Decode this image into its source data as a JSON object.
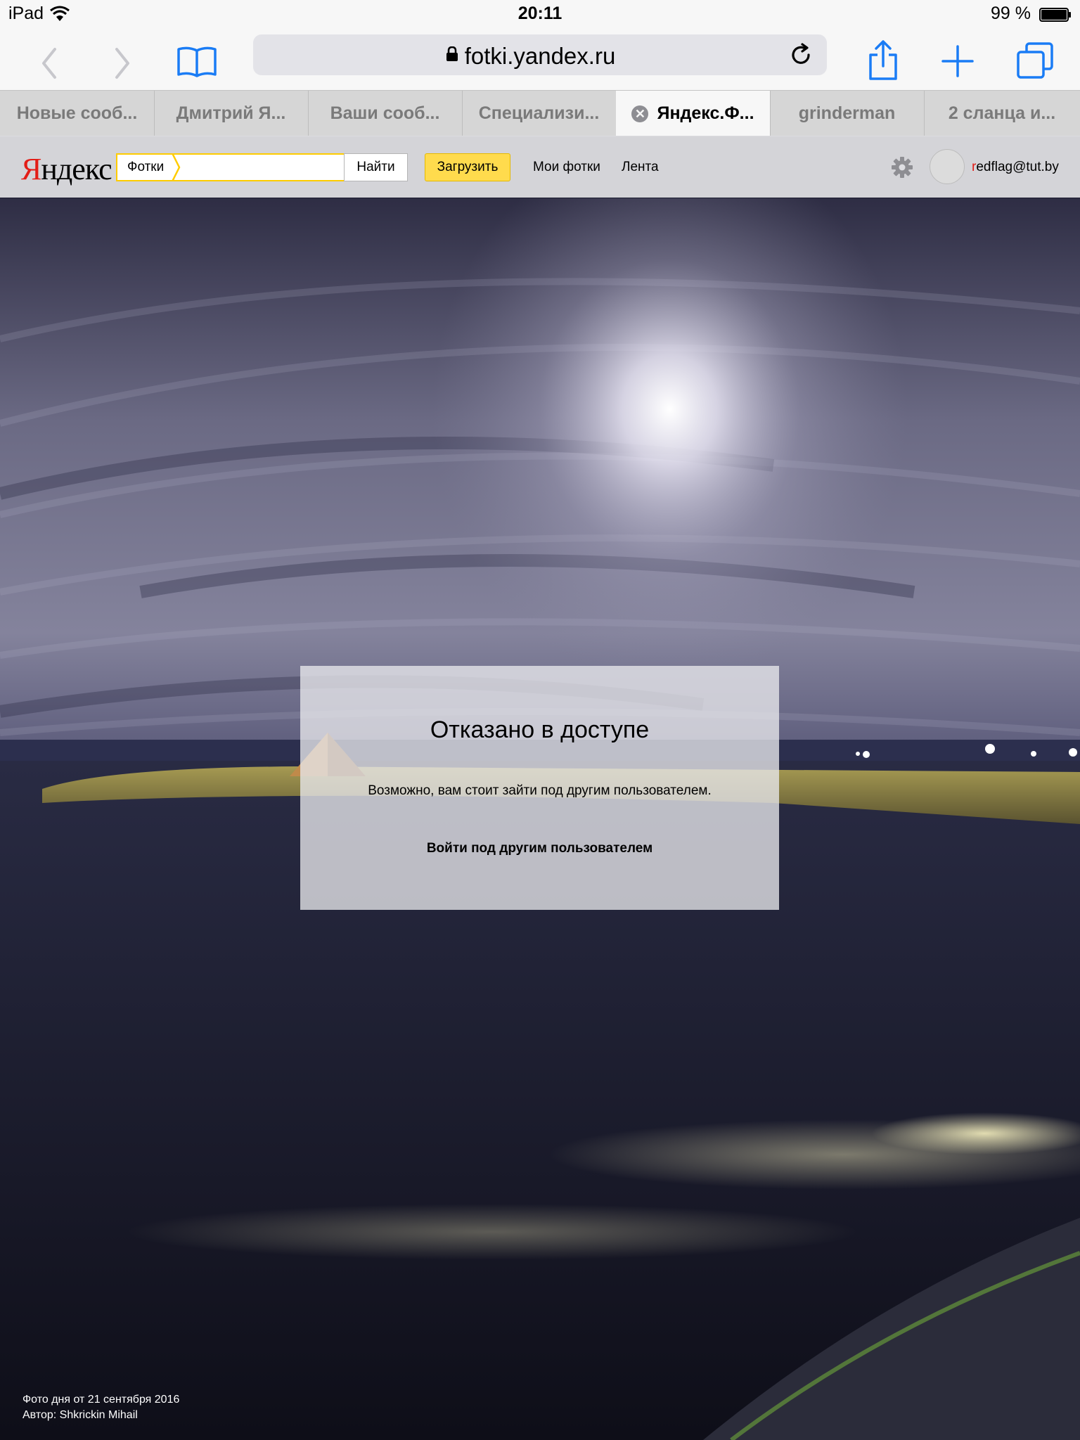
{
  "status_bar": {
    "carrier": "iPad",
    "time": "20:11",
    "battery": "99 %"
  },
  "toolbar": {
    "url": "fotki.yandex.ru"
  },
  "tabs": [
    {
      "label": "Новые сооб..."
    },
    {
      "label": "Дмитрий Я..."
    },
    {
      "label": "Ваши сооб..."
    },
    {
      "label": "Специализи..."
    },
    {
      "label": "Яндекс.Ф...",
      "active": true
    },
    {
      "label": "grinderman"
    },
    {
      "label": "2 сланца и..."
    }
  ],
  "header": {
    "logo": "Яндекс",
    "search_tag": "Фотки",
    "search_value": "",
    "search_button": "Найти",
    "upload_button": "Загрузить",
    "nav": [
      "Мои фотки",
      "Лента"
    ],
    "user_first_letter": "r",
    "user_rest": "edflag@tut.by"
  },
  "dialog": {
    "title": "Отказано в доступе",
    "message": "Возможно, вам стоит зайти под другим пользователем.",
    "relogin": "Войти под другим пользователем"
  },
  "caption": {
    "line1": "Фото дня от 21 сентября 2016",
    "line2": "Автор: Shkrickin Mihail"
  },
  "colors": {
    "ios_blue": "#1a7cf5",
    "yandex_red": "#e31d17",
    "upload_yellow": "#ffdb4d"
  },
  "icons": [
    "wifi-icon",
    "battery-icon",
    "back-icon",
    "forward-icon",
    "bookmarks-icon",
    "lock-icon",
    "reload-icon",
    "share-icon",
    "new-tab-icon",
    "tabs-icon",
    "close-tab-icon",
    "gear-icon"
  ]
}
